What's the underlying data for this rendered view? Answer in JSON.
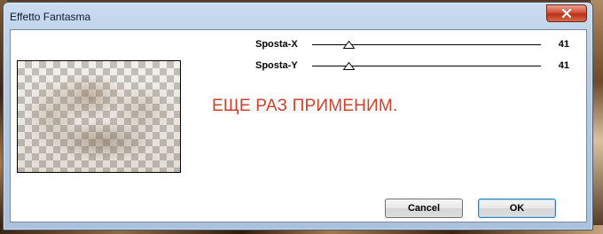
{
  "window": {
    "title": "Effetto Fantasma",
    "close_icon": "close-icon"
  },
  "sliders": [
    {
      "label": "Sposta-X",
      "value": "41",
      "position": 0.16
    },
    {
      "label": "Sposta-Y",
      "value": "41",
      "position": 0.16
    }
  ],
  "note": "ЕЩЕ РАЗ ПРИМЕНИМ.",
  "buttons": {
    "cancel": "Cancel",
    "ok": "OK"
  },
  "colors": {
    "note": "#d2402a",
    "close_button": "#c8462c",
    "title_bar": "#b7cde4"
  }
}
